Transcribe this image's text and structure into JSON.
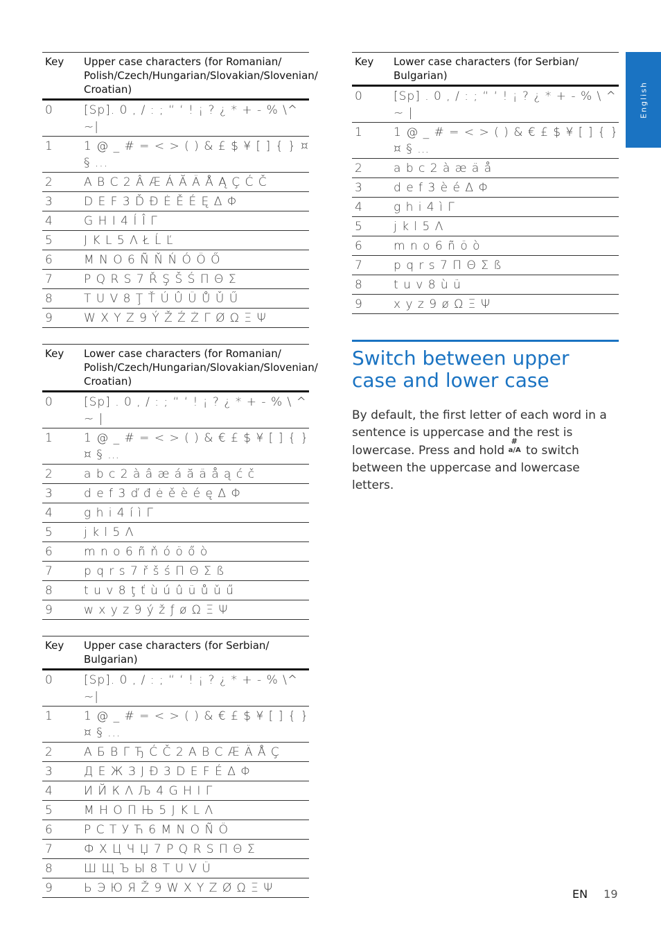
{
  "side_tab": {
    "label": "English",
    "color": "#1a73c2"
  },
  "tables_left": [
    {
      "header": {
        "key": "Key",
        "chars": "Upper case characters (for Romanian/ Polish/Czech/Hungarian/Slovakian/Slovenian/ Croatian)"
      },
      "rows": [
        {
          "key": "0",
          "chars": "[Sp]. 0 , / : ; “ ‘ ! ¡ ? ¿ * + - % \\^ ~|"
        },
        {
          "key": "1",
          "chars": "1 @ _ # = < > ( ) & £ $ ¥ [ ] { } ¤ § ..."
        },
        {
          "key": "2",
          "chars": "A B C 2 Â Æ Á Ă Ä Å Ą Ç Ć Č"
        },
        {
          "key": "3",
          "chars": "D E F 3 Ď Đ Ė Ě É Ę Δ Φ"
        },
        {
          "key": "4",
          "chars": "G H I 4 Í Î Γ"
        },
        {
          "key": "5",
          "chars": "J K L 5 Λ Ł Ĺ Ľ"
        },
        {
          "key": "6",
          "chars": "M N O 6 Ñ Ň Ń Ó Ö Ő"
        },
        {
          "key": "7",
          "chars": "P Q R S 7 Ř Ş Š Ś Π Θ Σ"
        },
        {
          "key": "8",
          "chars": "T U V 8 Ţ Ť Ú Û Ü Ů Ǔ Ű"
        },
        {
          "key": "9",
          "chars": "W X Y Z 9 Ý Ž Ź Ż Γ Ø Ω Ξ Ψ"
        }
      ]
    },
    {
      "header": {
        "key": "Key",
        "chars": "Lower case characters (for Romanian/ Polish/Czech/Hungarian/Slovakian/Slovenian/ Croatian)"
      },
      "rows": [
        {
          "key": "0",
          "chars": "[Sp] . 0 , / : ; “ ‘ ! ¡ ? ¿ * + - % \\ ^ ~ |"
        },
        {
          "key": "1",
          "chars": "1 @ _ # = < > ( ) & € £ $ ¥ [ ] { } ¤ § …"
        },
        {
          "key": "2",
          "chars": "a b c 2 à â æ á ă ä å ą ć č"
        },
        {
          "key": "3",
          "chars": "d e f 3 ď đ ė ě è é ę Δ Φ"
        },
        {
          "key": "4",
          "chars": "g h i 4 í ì Γ"
        },
        {
          "key": "5",
          "chars": "j k l 5 Λ"
        },
        {
          "key": "6",
          "chars": "m n o 6 ñ ň ó ö ő ò"
        },
        {
          "key": "7",
          "chars": "p q r s 7 ř š ś Π Θ Σ ß"
        },
        {
          "key": "8",
          "chars": "t u v 8 ţ ť ù ú û ü ů ǔ ű"
        },
        {
          "key": "9",
          "chars": "w x y z 9 ý ž ƒ ø Ω Ξ Ψ"
        }
      ]
    },
    {
      "header": {
        "key": "Key",
        "chars": "Upper case characters (for Serbian/ Bulgarian)"
      },
      "rows": [
        {
          "key": "0",
          "chars": "[Sp]. 0 , / : ; “ ‘ ! ¡ ? ¿ * + - % \\^ ~|"
        },
        {
          "key": "1",
          "chars": "1 @ _ # = < > ( ) & € £ $ ¥ [ ] { } ¤ § ..."
        },
        {
          "key": "2",
          "chars": "А Б В Г Ђ Ć Č 2 A B C Æ Ä Å Ç"
        },
        {
          "key": "3",
          "chars": "Д Е Ж З Ј Đ 3 D E F É Δ Φ"
        },
        {
          "key": "4",
          "chars": "И Й К Λ Љ 4 G H I Γ"
        },
        {
          "key": "5",
          "chars": "М Н О П Њ 5 J K L Λ"
        },
        {
          "key": "6",
          "chars": "Р С Т У Ћ 6 M N O Ñ Ö"
        },
        {
          "key": "7",
          "chars": "Ф Х Ц Ч Џ 7 P Q R S Π Θ Σ"
        },
        {
          "key": "8",
          "chars": "Ш Щ Ъ Ы 8 T U V Ü"
        },
        {
          "key": "9",
          "chars": "Ь Э Ю Я Ž 9 W X Y Z Ø Ω Ξ Ψ"
        }
      ]
    }
  ],
  "tables_right": [
    {
      "header": {
        "key": "Key",
        "chars": "Lower case characters (for Serbian/ Bulgarian)"
      },
      "rows": [
        {
          "key": "0",
          "chars": "[Sp] . 0 , / : ; “ ‘ ! ¡ ? ¿ * + - % \\ ^ ~ |"
        },
        {
          "key": "1",
          "chars": "1 @ _ # = < > ( ) & € £ $ ¥ [ ] { } ¤ § …"
        },
        {
          "key": "2",
          "chars": "a b c 2 à æ ä å"
        },
        {
          "key": "3",
          "chars": "d e f 3 è é Δ Φ"
        },
        {
          "key": "4",
          "chars": "g h i 4 ì Γ"
        },
        {
          "key": "5",
          "chars": "j k l 5 Λ"
        },
        {
          "key": "6",
          "chars": "m n o 6 ñ ö ò"
        },
        {
          "key": "7",
          "chars": "p q r s 7 Π Θ Σ ß"
        },
        {
          "key": "8",
          "chars": "t u v 8 ù ü"
        },
        {
          "key": "9",
          "chars": "x y z 9 ø Ω Ξ Ψ"
        }
      ]
    }
  ],
  "section": {
    "title": "Switch between upper case and lower case",
    "body_before_icon": "By default, the first letter of each word in a sentence is uppercase and the rest is lowercase. Press and hold",
    "icon": {
      "name": "hash-case-key-icon",
      "top": "#",
      "bottom": "a/A"
    },
    "body_after_icon": "to switch between the uppercase and lowercase letters."
  },
  "footer": {
    "language": "EN",
    "page_number": "19"
  }
}
